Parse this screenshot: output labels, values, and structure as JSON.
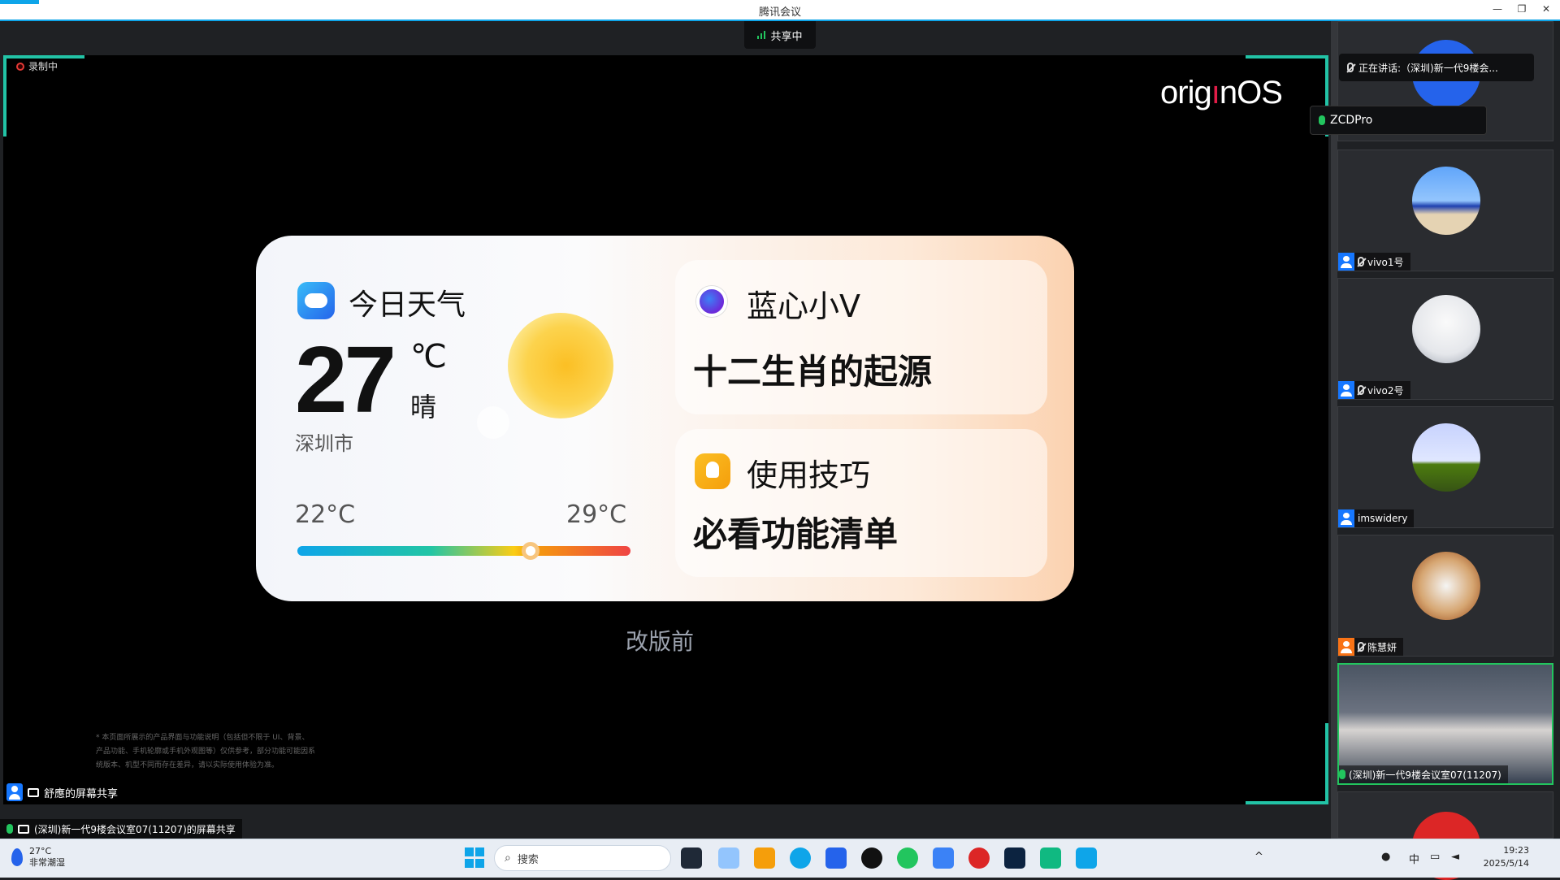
{
  "window": {
    "title": "腾讯会议",
    "minimize": "—",
    "restore": "❐",
    "close": "✕"
  },
  "share_badge": "共享中",
  "recording": "录制中",
  "slide": {
    "logo_text_a": "orig",
    "logo_text_b": "n",
    "logo_text_c": "OS",
    "weather": {
      "title": "今日天气",
      "temp": "27",
      "unit": "℃",
      "condition": "晴",
      "city": "深圳市",
      "low": "22°C",
      "high": "29°C",
      "current_fraction": 0.7
    },
    "assistant": {
      "title": "蓝心小V",
      "text": "十二生肖的起源"
    },
    "tips": {
      "title": "使用技巧",
      "text": "必看功能清单"
    },
    "caption": "改版前",
    "disclaimer": "* 本页面所展示的产品界面与功能说明（包括但不限于 UI、背景、产品功能、手机轮廓或手机外观图等）仅供参考，部分功能可能因系统版本、机型不同而存在差异，请以实际使用体验为准。"
  },
  "presenter_label": "舒應的屏幕共享",
  "bottom_share_label": "(深圳)新一代9楼会议室07(11207)的屏幕共享",
  "speaking": "正在讲话:（深圳)新一代9楼会...",
  "zcd_label": "ZCDPro",
  "participants": [
    {
      "name": "vivo1号"
    },
    {
      "name": "vivo2号"
    },
    {
      "name": "imswidery"
    },
    {
      "name": "陈慧妍"
    },
    {
      "name": "(深圳)新一代9楼会议室07(11207)"
    }
  ],
  "taskbar": {
    "weather_temp": "27°C",
    "weather_desc": "非常潮湿",
    "search_placeholder": "搜索",
    "ime": "中",
    "time": "19:23",
    "date": "2025/5/14"
  },
  "colors": {
    "accent": "#0ea5e9",
    "active_border": "#22c3a6"
  }
}
